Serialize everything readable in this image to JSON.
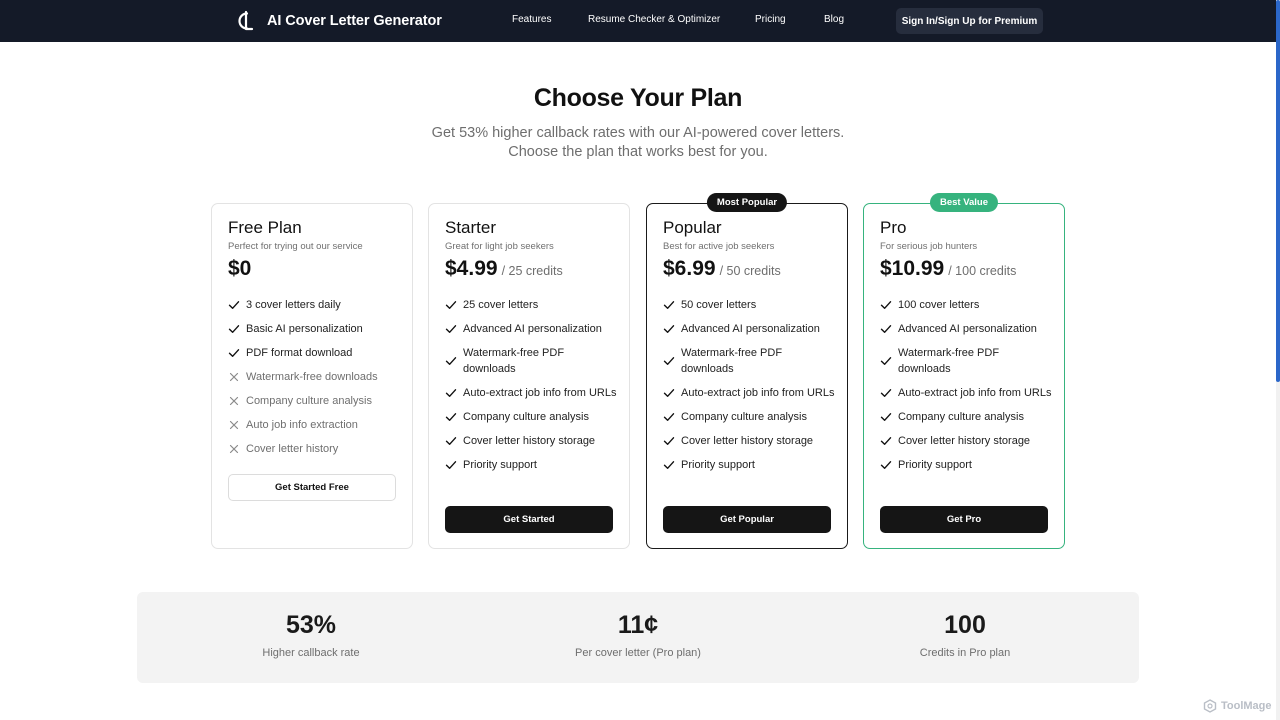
{
  "header": {
    "brand_title": "AI Cover Letter Generator",
    "nav": [
      "Features",
      "Resume Checker & Optimizer",
      "Pricing",
      "Blog"
    ],
    "signin_label": "Sign In/Sign Up for Premium"
  },
  "hero": {
    "title": "Choose Your Plan",
    "subtitle_line1": "Get 53% higher callback rates with our AI-powered cover letters.",
    "subtitle_line2": "Choose the plan that works best for you."
  },
  "plans": [
    {
      "name": "Free Plan",
      "desc": "Perfect for trying out our service",
      "price": "$0",
      "unit": "",
      "badge": "",
      "features": [
        {
          "text": "3 cover letters daily",
          "included": true
        },
        {
          "text": "Basic AI personalization",
          "included": true
        },
        {
          "text": "PDF format download",
          "included": true
        },
        {
          "text": "Watermark-free downloads",
          "included": false
        },
        {
          "text": "Company culture analysis",
          "included": false
        },
        {
          "text": "Auto job info extraction",
          "included": false
        },
        {
          "text": "Cover letter history",
          "included": false
        }
      ],
      "cta": "Get Started Free"
    },
    {
      "name": "Starter",
      "desc": "Great for light job seekers",
      "price": "$4.99",
      "unit": "/ 25 credits",
      "badge": "",
      "features": [
        {
          "text": "25 cover letters",
          "included": true
        },
        {
          "text": "Advanced AI personalization",
          "included": true
        },
        {
          "text": "Watermark-free PDF downloads",
          "included": true
        },
        {
          "text": "Auto-extract job info from URLs",
          "included": true
        },
        {
          "text": "Company culture analysis",
          "included": true
        },
        {
          "text": "Cover letter history storage",
          "included": true
        },
        {
          "text": "Priority support",
          "included": true
        }
      ],
      "cta": "Get Started"
    },
    {
      "name": "Popular",
      "desc": "Best for active job seekers",
      "price": "$6.99",
      "unit": "/ 50 credits",
      "badge": "Most Popular",
      "features": [
        {
          "text": "50 cover letters",
          "included": true
        },
        {
          "text": "Advanced AI personalization",
          "included": true
        },
        {
          "text": "Watermark-free PDF downloads",
          "included": true
        },
        {
          "text": "Auto-extract job info from URLs",
          "included": true
        },
        {
          "text": "Company culture analysis",
          "included": true
        },
        {
          "text": "Cover letter history storage",
          "included": true
        },
        {
          "text": "Priority support",
          "included": true
        }
      ],
      "cta": "Get Popular"
    },
    {
      "name": "Pro",
      "desc": "For serious job hunters",
      "price": "$10.99",
      "unit": "/ 100 credits",
      "badge": "Best Value",
      "features": [
        {
          "text": "100 cover letters",
          "included": true
        },
        {
          "text": "Advanced AI personalization",
          "included": true
        },
        {
          "text": "Watermark-free PDF downloads",
          "included": true
        },
        {
          "text": "Auto-extract job info from URLs",
          "included": true
        },
        {
          "text": "Company culture analysis",
          "included": true
        },
        {
          "text": "Cover letter history storage",
          "included": true
        },
        {
          "text": "Priority support",
          "included": true
        }
      ],
      "cta": "Get Pro"
    }
  ],
  "stats": [
    {
      "value": "53%",
      "label": "Higher callback rate"
    },
    {
      "value": "11¢",
      "label": "Per cover letter (Pro plan)"
    },
    {
      "value": "100",
      "label": "Credits in Pro plan"
    }
  ],
  "watermark": "ToolMage",
  "colors": {
    "nav_bg": "#141a28",
    "accent_green": "#36b37e",
    "cta_dark": "#151515",
    "scrollbar": "#2b67c9"
  },
  "icons": {
    "brand": "cl-logo-icon",
    "included": "check-icon",
    "excluded": "x-icon",
    "watermark": "toolmage-logo-icon"
  }
}
